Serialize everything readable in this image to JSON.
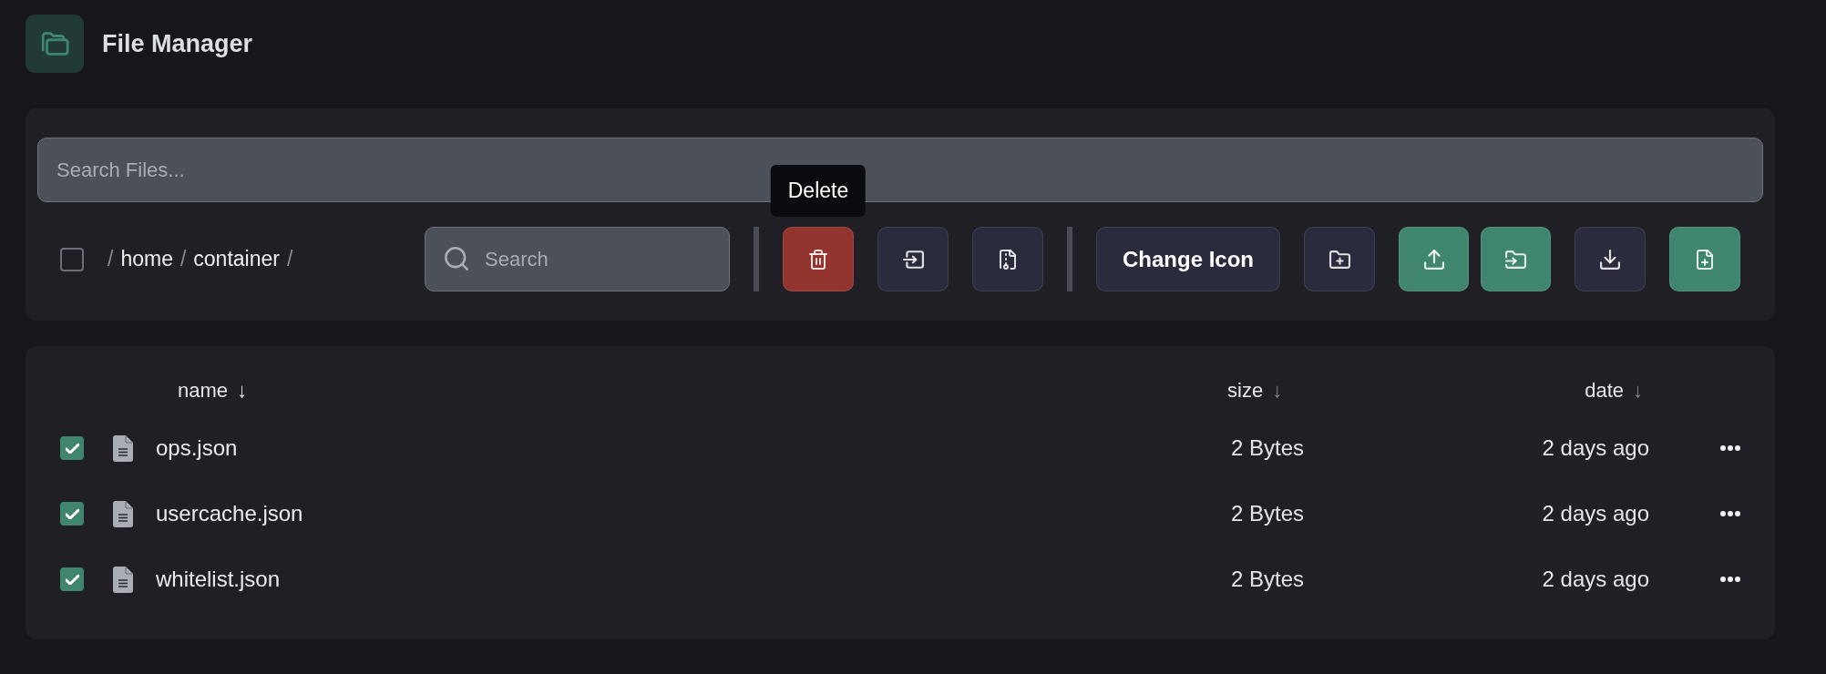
{
  "header": {
    "title": "File Manager"
  },
  "toolbar": {
    "search_files": {
      "placeholder": "Search Files..."
    },
    "select_all": {
      "checked": false
    },
    "breadcrumb": [
      {
        "kind": "separator",
        "text": "/"
      },
      {
        "kind": "folder",
        "text": "home"
      },
      {
        "kind": "separator",
        "text": "/"
      },
      {
        "kind": "folder",
        "text": "container"
      },
      {
        "kind": "separator",
        "text": "/"
      }
    ],
    "search": {
      "placeholder": "Search"
    },
    "actions": [
      {
        "kind": "divider"
      },
      {
        "kind": "delete",
        "color": "#93342f",
        "tooltip": "Delete"
      },
      {
        "kind": "move",
        "color": "#2a2b3d"
      },
      {
        "kind": "compress",
        "color": "#2a2b3d"
      },
      {
        "kind": "divider"
      },
      {
        "kind": "text",
        "label": "Change Icon",
        "color": "#2a2b3d"
      },
      {
        "kind": "newfolder",
        "color": "#2a2b3d"
      },
      {
        "kind": "group",
        "buttons": [
          {
            "kind": "upload",
            "color": "#40866f"
          },
          {
            "kind": "import",
            "color": "#40866f"
          }
        ]
      },
      {
        "kind": "download",
        "color": "#2a2b3d"
      },
      {
        "kind": "newfile",
        "color": "#40866f"
      }
    ]
  },
  "table": {
    "columns": [
      {
        "label": "name",
        "arrow": "↓",
        "active": true
      },
      {
        "label": "size",
        "arrow": "↓",
        "active": false
      },
      {
        "label": "date",
        "arrow": "↓",
        "active": false
      }
    ],
    "rows": [
      {
        "checked": true,
        "name": "ops.json",
        "size": "2 Bytes",
        "date": "2 days ago"
      },
      {
        "checked": true,
        "name": "usercache.json",
        "size": "2 Bytes",
        "date": "2 days ago"
      },
      {
        "checked": true,
        "name": "whitelist.json",
        "size": "2 Bytes",
        "date": "2 days ago"
      }
    ]
  }
}
